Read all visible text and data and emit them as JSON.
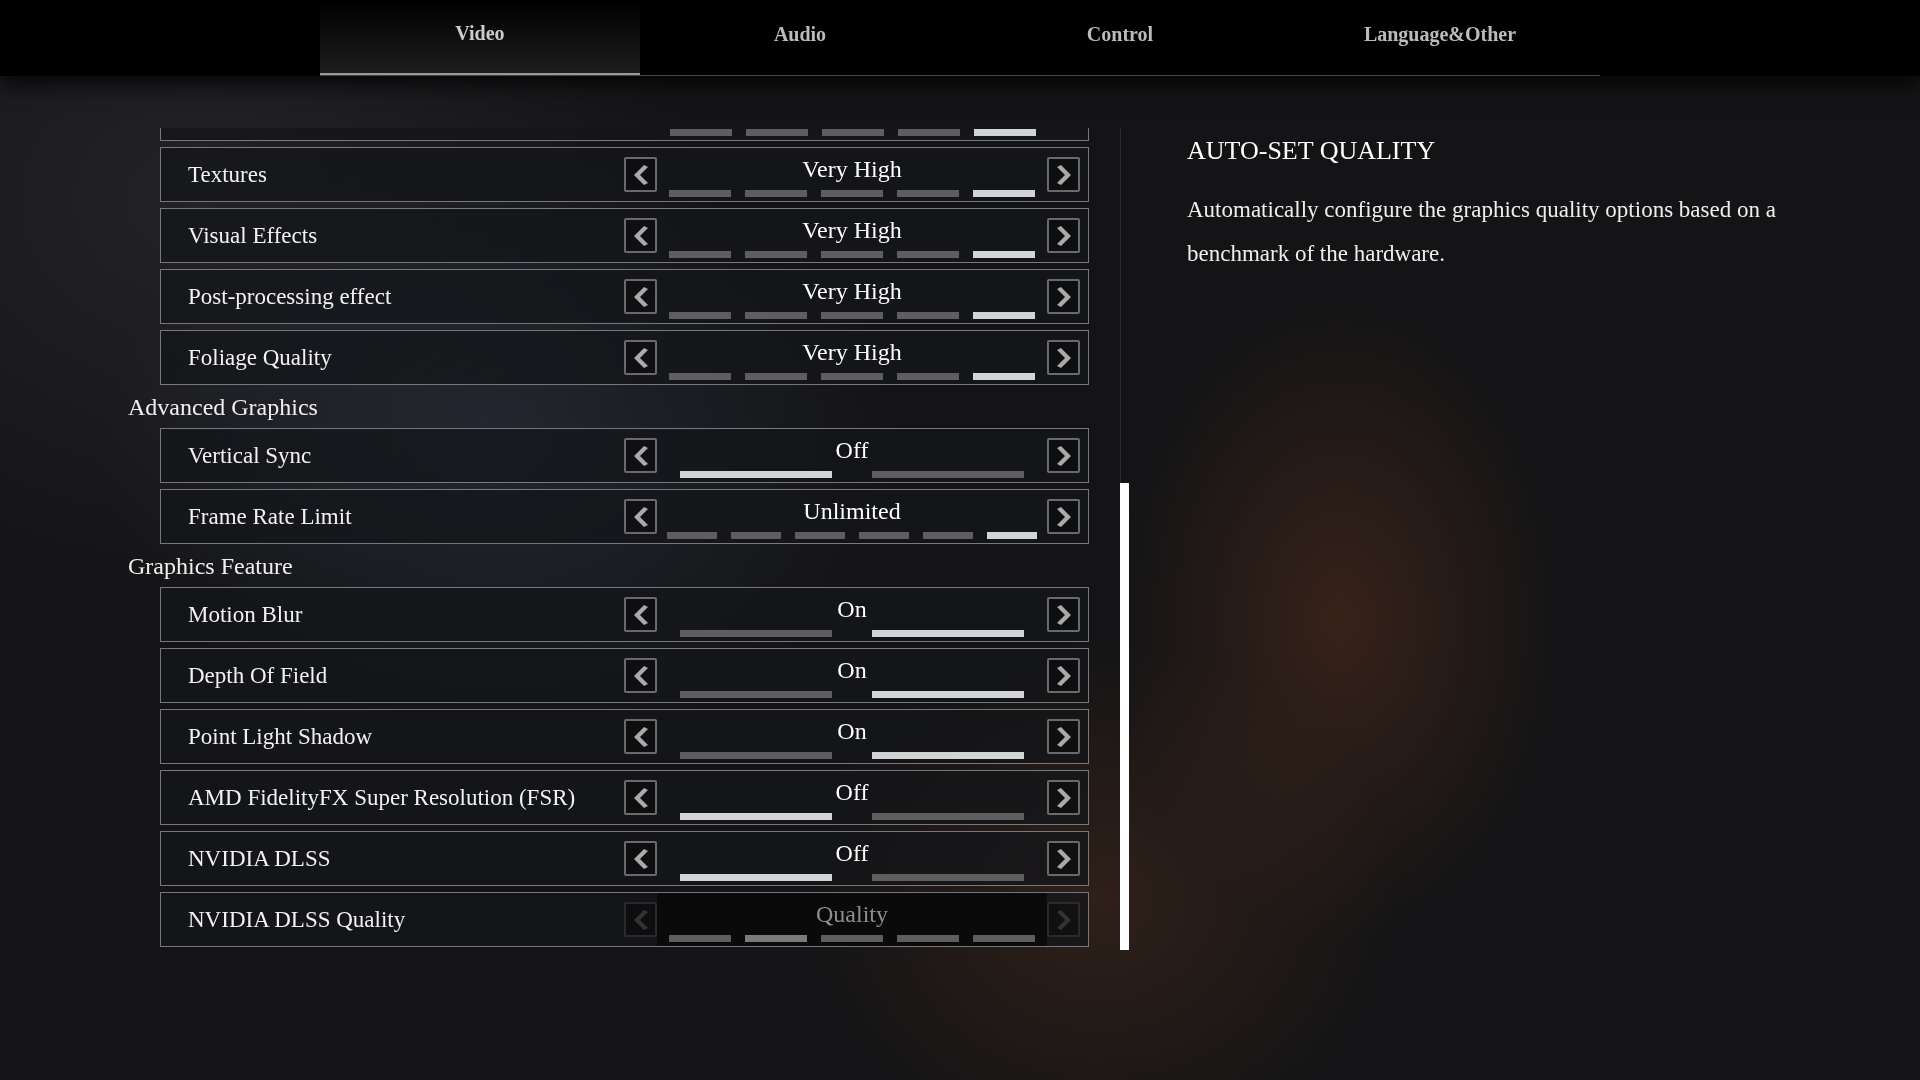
{
  "tabs": [
    {
      "label": "Video",
      "selected": true
    },
    {
      "label": "Audio",
      "selected": false
    },
    {
      "label": "Control",
      "selected": false
    },
    {
      "label": "Language&Other",
      "selected": false
    }
  ],
  "settings": [
    {
      "kind": "partial",
      "segments": [
        {
          "selected": false
        },
        {
          "selected": false
        },
        {
          "selected": false
        },
        {
          "selected": false
        },
        {
          "selected": true
        }
      ]
    },
    {
      "kind": "row",
      "label": "Textures",
      "value": "Very High",
      "disabled": false,
      "segments": [
        {
          "selected": false
        },
        {
          "selected": false
        },
        {
          "selected": false
        },
        {
          "selected": false
        },
        {
          "selected": true
        }
      ]
    },
    {
      "kind": "row",
      "label": "Visual Effects",
      "value": "Very High",
      "disabled": false,
      "segments": [
        {
          "selected": false
        },
        {
          "selected": false
        },
        {
          "selected": false
        },
        {
          "selected": false
        },
        {
          "selected": true
        }
      ]
    },
    {
      "kind": "row",
      "label": "Post-processing effect",
      "value": "Very High",
      "disabled": false,
      "segments": [
        {
          "selected": false
        },
        {
          "selected": false
        },
        {
          "selected": false
        },
        {
          "selected": false
        },
        {
          "selected": true
        }
      ]
    },
    {
      "kind": "row",
      "label": "Foliage Quality",
      "value": "Very High",
      "disabled": false,
      "segments": [
        {
          "selected": false
        },
        {
          "selected": false
        },
        {
          "selected": false
        },
        {
          "selected": false
        },
        {
          "selected": true
        }
      ]
    },
    {
      "kind": "section",
      "label": "Advanced Graphics"
    },
    {
      "kind": "row",
      "label": "Vertical Sync",
      "value": "Off",
      "disabled": false,
      "segments": [
        {
          "selected": true
        },
        {
          "selected": false
        }
      ]
    },
    {
      "kind": "row",
      "label": "Frame Rate Limit",
      "value": "Unlimited",
      "disabled": false,
      "segments": [
        {
          "selected": false
        },
        {
          "selected": false
        },
        {
          "selected": false
        },
        {
          "selected": false
        },
        {
          "selected": false
        },
        {
          "selected": true
        }
      ]
    },
    {
      "kind": "section",
      "label": "Graphics Feature"
    },
    {
      "kind": "row",
      "label": "Motion Blur",
      "value": "On",
      "disabled": false,
      "segments": [
        {
          "selected": false
        },
        {
          "selected": true
        }
      ]
    },
    {
      "kind": "row",
      "label": "Depth Of Field",
      "value": "On",
      "disabled": false,
      "segments": [
        {
          "selected": false
        },
        {
          "selected": true
        }
      ]
    },
    {
      "kind": "row",
      "label": "Point Light Shadow",
      "value": "On",
      "disabled": false,
      "segments": [
        {
          "selected": false
        },
        {
          "selected": true
        }
      ]
    },
    {
      "kind": "row",
      "label": "AMD FidelityFX Super Resolution (FSR)",
      "value": "Off",
      "disabled": false,
      "segments": [
        {
          "selected": true
        },
        {
          "selected": false
        }
      ]
    },
    {
      "kind": "row",
      "label": "NVIDIA DLSS",
      "value": "Off",
      "disabled": false,
      "segments": [
        {
          "selected": true
        },
        {
          "selected": false
        }
      ]
    },
    {
      "kind": "row",
      "label": "NVIDIA DLSS Quality",
      "value": "Quality",
      "disabled": true,
      "segments": [
        {
          "selected": false
        },
        {
          "selected": true
        },
        {
          "selected": false
        },
        {
          "selected": false
        },
        {
          "selected": false
        }
      ]
    }
  ],
  "panel": {
    "title": "AUTO-SET QUALITY",
    "description": "Automatically configure the graphics quality options based on a benchmark of the hardware."
  }
}
